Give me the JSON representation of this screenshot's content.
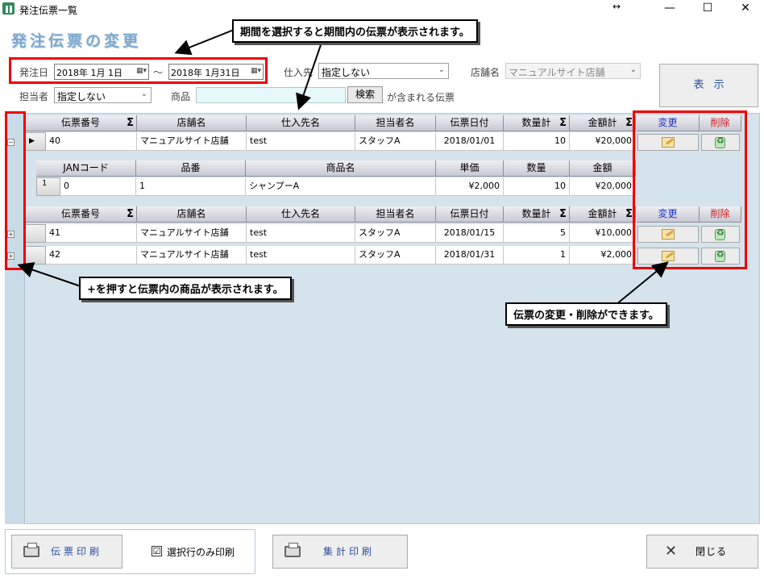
{
  "window": {
    "title": "発注伝票一覧",
    "resize_glyph": "↔",
    "minimize": "—",
    "maximize": "☐",
    "close": "✕"
  },
  "heading": "発注伝票の変更",
  "filters": {
    "order_date_label": "発注日",
    "date_from": "2018年  1月  1日",
    "date_to": "2018年  1月31日",
    "tilde": "～",
    "supplier_label": "仕入先",
    "supplier_value": "指定しない",
    "store_label": "店舗名",
    "store_value": "マニュアルサイト店舗",
    "staff_label": "担当者",
    "staff_value": "指定しない",
    "product_label": "商品",
    "product_value": "",
    "search_button": "検索",
    "contains_note": "が含まれる伝票",
    "display_button": "表示"
  },
  "grid": {
    "columns": [
      "伝票番号",
      "店舗名",
      "仕入先名",
      "担当者名",
      "伝票日付",
      "数量計",
      "金額計"
    ],
    "edit_header": "変更",
    "delete_header": "削除",
    "rows": [
      {
        "no": "40",
        "store": "マニュアルサイト店舗",
        "supplier": "test",
        "staff": "スタッフA",
        "date": "2018/01/01",
        "qty": "10",
        "amount": "¥20,000"
      },
      {
        "no": "41",
        "store": "マニュアルサイト店舗",
        "supplier": "test",
        "staff": "スタッフA",
        "date": "2018/01/15",
        "qty": "5",
        "amount": "¥10,000"
      },
      {
        "no": "42",
        "store": "マニュアルサイト店舗",
        "supplier": "test",
        "staff": "スタッフA",
        "date": "2018/01/31",
        "qty": "1",
        "amount": "¥2,000"
      }
    ],
    "detail_columns": [
      "JANコード",
      "品番",
      "商品名",
      "単価",
      "数量",
      "金額"
    ],
    "detail_row": {
      "rownum": "1",
      "jan": "0",
      "part": "1",
      "name": "シャンプーA",
      "price": "¥2,000",
      "qty": "10",
      "amount": "¥20,000"
    }
  },
  "callouts": {
    "period": "期間を選択すると期間内の伝票が表示されます。",
    "plus": "+を押すと伝票内の商品が表示されます。",
    "edit_delete": "伝票の変更・削除ができます。"
  },
  "bottom": {
    "print_slip": "伝票印刷",
    "selected_only": "選択行のみ印刷",
    "selected_only_checked": "☑",
    "print_summary": "集計印刷",
    "close": "閉じる"
  }
}
